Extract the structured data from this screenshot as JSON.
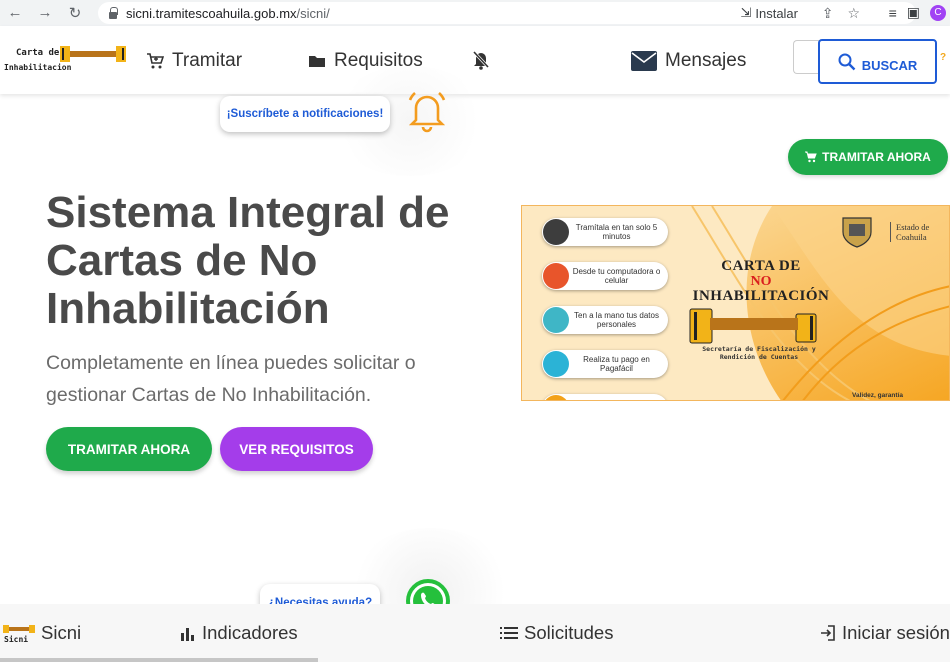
{
  "browser": {
    "url_domain": "sicni.tramitescoahuila.gob.mx",
    "url_path": "/sicni/",
    "install_label": "Instalar",
    "profile_initial": "C"
  },
  "header": {
    "logo_line1": "Carta de",
    "logo_line2": "Inhabilitacion",
    "nav": {
      "tramitar": "Tramitar",
      "requisitos": "Requisitos",
      "mensajes": "Mensajes"
    },
    "search_label": "BUSCAR",
    "help_mark": "?"
  },
  "notification_prompt": "¡Suscríbete a notificaciones!",
  "tramitar_top_label": "TRAMITAR AHORA",
  "hero": {
    "title": "Sistema Integral de Cartas de No Inhabilitación",
    "subtitle": "Completamente en línea puedes solicitar o gestionar Cartas de No Inhabilitación.",
    "primary_button": "TRAMITAR AHORA",
    "secondary_button": "VER REQUISITOS"
  },
  "banner": {
    "steps": [
      {
        "text": "Tramítala en tan solo 5 minutos",
        "icon": "clock-icon",
        "color": "#3d3d3d"
      },
      {
        "text": "Desde tu computadora o celular",
        "icon": "computer-icon",
        "color": "#e8552b"
      },
      {
        "text": "Ten a la mano tus datos personales",
        "icon": "id-card-icon",
        "color": "#3fb6c6"
      },
      {
        "text": "Realiza tu pago en Pagafácil",
        "icon": "payment-icon",
        "color": "#2bb3d6"
      },
      {
        "text": "",
        "icon": "download-icon",
        "color": "#f3a21a"
      }
    ],
    "title_line1": "CARTA DE",
    "title_line2": "NO",
    "title_line3": "INHABILITACIÓN",
    "secretaria": "Secretaría de Fiscalización y Rendición de Cuentas",
    "estado": "Estado de Coahuila",
    "validez": "Validez, garantía"
  },
  "help_prompt": "¿Necesitas ayuda?",
  "footer": {
    "brand": "Sicni",
    "indicadores": "Indicadores",
    "solicitudes": "Solicitudes",
    "iniciar_sesion": "Iniciar sesión"
  },
  "colors": {
    "green": "#1faa4b",
    "purple": "#a43dea",
    "blue": "#1e5bd6",
    "orange": "#f39c1f",
    "whatsapp": "#25c03c"
  }
}
